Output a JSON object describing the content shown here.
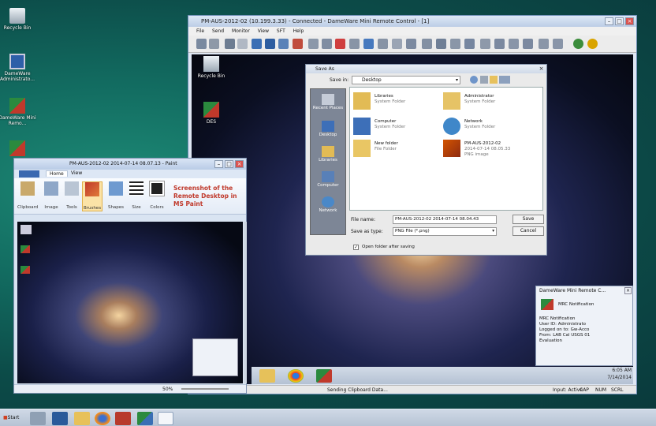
{
  "desktop": {
    "icons": [
      "Recycle Bin",
      "DameWare Administrato...",
      "DameWare Mini Remo...",
      ""
    ]
  },
  "remote": {
    "title": "PM-AUS-2012-02 (10.199.3.33) - Connected - DameWare Mini Remote Control - [1]",
    "menu": [
      "File",
      "Send",
      "Monitor",
      "View",
      "SFT",
      "Help"
    ],
    "desktop_icons": [
      "Recycle Bin",
      "DES"
    ],
    "status_text": "Sending Clipboard Data...",
    "status_right": [
      "Input: Active",
      "CAP",
      "NUM",
      "SCRL"
    ],
    "clock_time": "6:05 AM",
    "clock_date": "7/14/2014"
  },
  "saveas": {
    "title": "Save As",
    "save_in_label": "Save in:",
    "save_in_value": "Desktop",
    "places": [
      "Recent Places",
      "Desktop",
      "Libraries",
      "Computer",
      "Network"
    ],
    "files": [
      {
        "name": "Libraries",
        "type": "System Folder"
      },
      {
        "name": "Administrator",
        "type": "System Folder"
      },
      {
        "name": "Computer",
        "type": "System Folder"
      },
      {
        "name": "Network",
        "type": "System Folder"
      },
      {
        "name": "New folder",
        "type": "File Folder"
      },
      {
        "name": "PM-AUS-2012-02",
        "type": "2014-07-14 08.05.33",
        "extra": "PNG image"
      }
    ],
    "filename_label": "File name:",
    "filename_value": "PM-AUS-2012-02 2014-07-14 08.04.43",
    "type_label": "Save as type:",
    "type_value": "PNG File (*.png)",
    "save_button": "Save",
    "cancel_button": "Cancel",
    "open_folder_label": "Open folder after saving"
  },
  "paint": {
    "title": "PM-AUS-2012-02 2014-07-14 08.07.13 - Paint",
    "tabs": [
      "Home",
      "View"
    ],
    "groups": [
      "Clipboard",
      "Image",
      "Tools",
      "Brushes",
      "Shapes",
      "Size",
      "Colors"
    ],
    "annotation": "Screenshot of the Remote Desktop in MS Paint",
    "zoom": "50%"
  },
  "notification": {
    "title": "DameWare Mini Remote C...",
    "header": "MRC Notification",
    "lines": [
      "MRC Notification",
      "User ID: Administrato",
      "Logged on to: Gw-Acco",
      "From: LAB Cal USGS 01",
      "Evaluation"
    ]
  },
  "taskbar": {
    "start": "Start"
  },
  "colors": {
    "titlebar": "#c9d7ec",
    "desktop": "#126b60",
    "accent_red": "#c0392b"
  }
}
